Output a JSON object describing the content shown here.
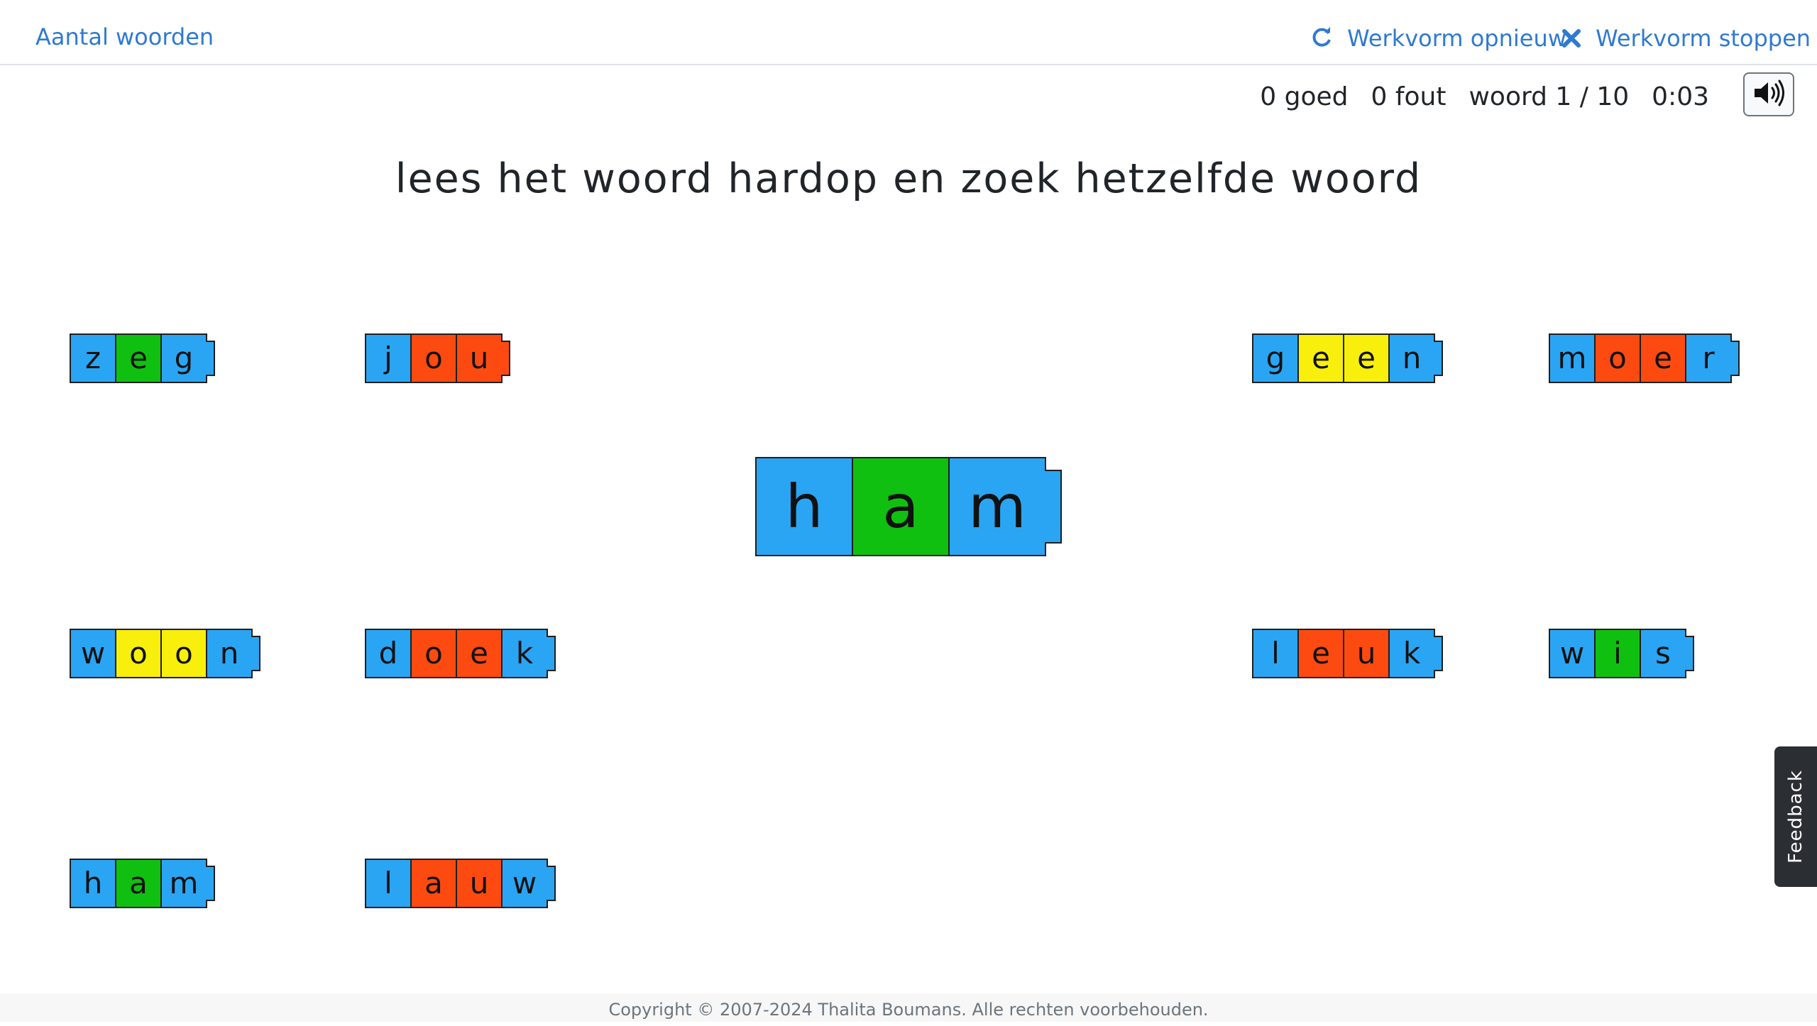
{
  "nav": {
    "left_link": "Aantal woorden",
    "restart_label": "Werkvorm opnieuw",
    "stop_label": "Werkvorm stoppen"
  },
  "status": {
    "correct": "0 goed",
    "wrong": "0 fout",
    "progress": "woord 1 / 10",
    "timer": "0:03"
  },
  "instruction": "lees het woord hardop en zoek hetzelfde woord",
  "target_word": {
    "letters": [
      {
        "l": "h",
        "c": "blue"
      },
      {
        "l": "a",
        "c": "green"
      },
      {
        "l": "m",
        "c": "blue"
      }
    ]
  },
  "choices": [
    {
      "word": "zeg",
      "letters": [
        {
          "l": "z",
          "c": "blue"
        },
        {
          "l": "e",
          "c": "green"
        },
        {
          "l": "g",
          "c": "blue"
        }
      ]
    },
    {
      "word": "jou",
      "letters": [
        {
          "l": "j",
          "c": "blue"
        },
        {
          "l": "o",
          "c": "red"
        },
        {
          "l": "u",
          "c": "red"
        }
      ]
    },
    {
      "word": "geen",
      "letters": [
        {
          "l": "g",
          "c": "blue"
        },
        {
          "l": "e",
          "c": "yellow"
        },
        {
          "l": "e",
          "c": "yellow"
        },
        {
          "l": "n",
          "c": "blue"
        }
      ]
    },
    {
      "word": "moer",
      "letters": [
        {
          "l": "m",
          "c": "blue"
        },
        {
          "l": "o",
          "c": "red"
        },
        {
          "l": "e",
          "c": "red"
        },
        {
          "l": "r",
          "c": "blue"
        }
      ]
    },
    {
      "word": "woon",
      "letters": [
        {
          "l": "w",
          "c": "blue"
        },
        {
          "l": "o",
          "c": "yellow"
        },
        {
          "l": "o",
          "c": "yellow"
        },
        {
          "l": "n",
          "c": "blue"
        }
      ]
    },
    {
      "word": "doek",
      "letters": [
        {
          "l": "d",
          "c": "blue"
        },
        {
          "l": "o",
          "c": "red"
        },
        {
          "l": "e",
          "c": "red"
        },
        {
          "l": "k",
          "c": "blue"
        }
      ]
    },
    {
      "word": "leuk",
      "letters": [
        {
          "l": "l",
          "c": "blue"
        },
        {
          "l": "e",
          "c": "red"
        },
        {
          "l": "u",
          "c": "red"
        },
        {
          "l": "k",
          "c": "blue"
        }
      ]
    },
    {
      "word": "wis",
      "letters": [
        {
          "l": "w",
          "c": "blue"
        },
        {
          "l": "i",
          "c": "green"
        },
        {
          "l": "s",
          "c": "blue"
        }
      ]
    },
    {
      "word": "ham",
      "letters": [
        {
          "l": "h",
          "c": "blue"
        },
        {
          "l": "a",
          "c": "green"
        },
        {
          "l": "m",
          "c": "blue"
        }
      ]
    },
    {
      "word": "lauw",
      "letters": [
        {
          "l": "l",
          "c": "blue"
        },
        {
          "l": "a",
          "c": "red"
        },
        {
          "l": "u",
          "c": "red"
        },
        {
          "l": "w",
          "c": "blue"
        }
      ]
    }
  ],
  "colors": {
    "blue": "#2aa5f4",
    "green": "#10c010",
    "yellow": "#f8ef0c",
    "red": "#fd4a10",
    "link": "#2f7ad0"
  },
  "icons": {
    "restart": "refresh-icon",
    "stop": "close-icon",
    "sound": "speaker-icon"
  },
  "footer": "Copyright © 2007-2024 Thalita Boumans. Alle rechten voorbehouden.",
  "feedback_tab": "Feedback"
}
